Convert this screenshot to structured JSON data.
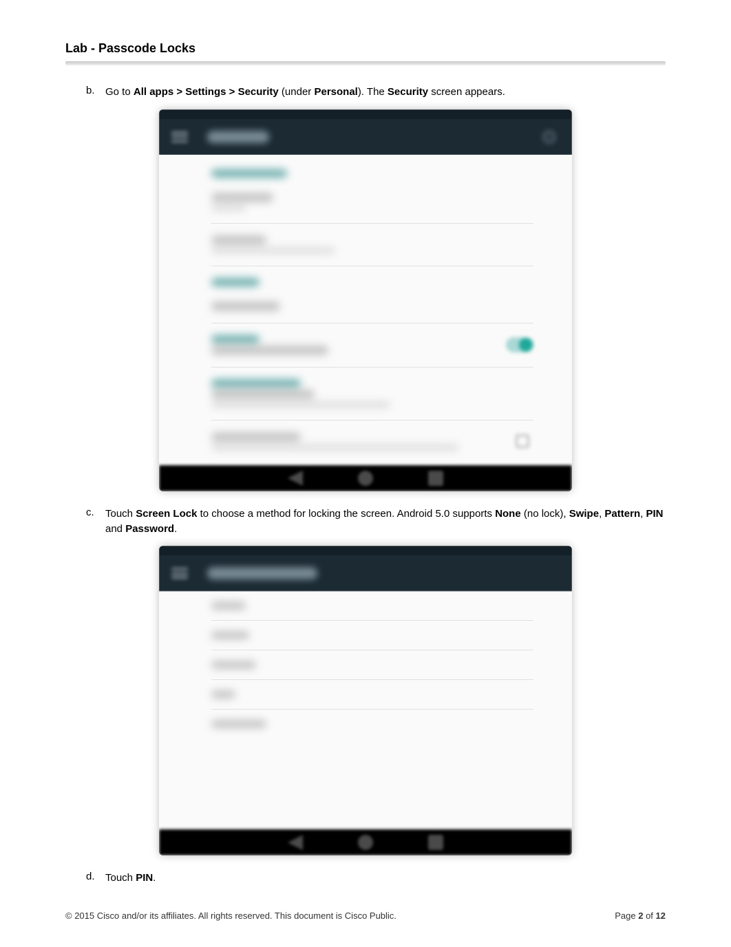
{
  "header": {
    "title": "Lab - Passcode Locks"
  },
  "steps": {
    "b": {
      "letter": "b.",
      "prefix": "Go to ",
      "breadcrumb": "All apps > Settings > Security",
      "mid1": " (under ",
      "personal": "Personal",
      "mid2": "). The ",
      "security": "Security",
      "suffix": " screen appears."
    },
    "c": {
      "letter": "c.",
      "prefix": "Touch ",
      "screen_lock": "Screen Lock",
      "mid1": " to choose a method for locking the screen. Android 5.0 supports ",
      "none": "None",
      "after_none": " (no lock), ",
      "swipe": "Swipe",
      "comma1": ", ",
      "pattern": "Pattern",
      "comma2": ", ",
      "pin": "PIN",
      "and": " and ",
      "password": "Password",
      "period": "."
    },
    "d": {
      "letter": "d.",
      "prefix": "Touch ",
      "pin": "PIN",
      "period": "."
    }
  },
  "screenshot1": {
    "title": "Security",
    "section1": "Screen security",
    "items": [
      {
        "title": "Screen lock",
        "sub": "Swipe"
      },
      {
        "title": "Owner info",
        "sub": ""
      },
      {
        "title": "Smart Lock",
        "sub": ""
      }
    ],
    "section2": "Encryption",
    "encrypt": {
      "title": "Encrypt tablet",
      "sub": "Encrypted"
    },
    "sim": {
      "title": "SIM card lock",
      "sub": "Set up SIM card lock"
    },
    "passwords_section": "Passwords",
    "make_visible": {
      "title": "Make passwords visible"
    },
    "device_admin_section": "Device administration",
    "device_admin": {
      "title": "Device administrators",
      "sub": "View or deactivate device administrators"
    },
    "unknown": {
      "title": "Unknown sources",
      "sub": "Allow installation of apps from unknown sources"
    }
  },
  "screenshot2": {
    "title": "Choose screen lock",
    "options": [
      "None",
      "Swipe",
      "Pattern",
      "PIN",
      "Password"
    ]
  },
  "footer": {
    "copyright": "© 2015 Cisco and/or its affiliates. All rights reserved. This document is Cisco Public.",
    "page_label_pre": "Page ",
    "page_current": "2",
    "page_of": " of ",
    "page_total": "12"
  }
}
